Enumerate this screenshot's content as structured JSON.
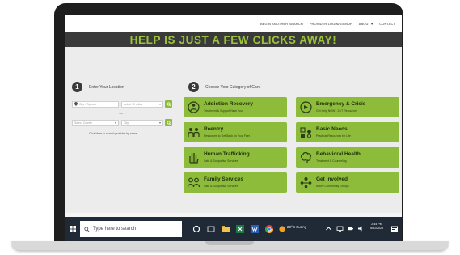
{
  "nav": {
    "items": [
      "BEGIN ANOTHER SEARCH",
      "PROVIDER LOGIN/SIGNUP",
      "ABOUT",
      "CONTACT"
    ],
    "about_chevron": "chevron-down-icon"
  },
  "banner": {
    "headline": "HELP IS JUST A FEW CLICKS AWAY!"
  },
  "step1": {
    "number": "1",
    "title": "Enter Your Location",
    "zip_placeholder": "City / Zipcode",
    "radius_value": "select 10 miles",
    "or_label": "- or -",
    "county_value": "Select County",
    "city_value": "City",
    "search_link_text": "Click Here to search provider by name"
  },
  "step2": {
    "number": "2",
    "title": "Choose Your Category of Care",
    "categories": [
      {
        "title": "Addiction Recovery",
        "subtitle": "Treatment & Support Near You",
        "icon": "recovery-icon"
      },
      {
        "title": "Emergency & Crisis",
        "subtitle": "Get Help NOW - 24/7 Resources",
        "icon": "emergency-icon"
      },
      {
        "title": "Reentry",
        "subtitle": "Resources to Get Back on Your Feet",
        "icon": "reentry-icon"
      },
      {
        "title": "Basic Needs",
        "subtitle": "Practical Resources for Life",
        "icon": "basic-needs-icon"
      },
      {
        "title": "Human Trafficking",
        "subtitle": "Safe & Supportive Services",
        "icon": "hand-icon"
      },
      {
        "title": "Behavioral Health",
        "subtitle": "Treatment & Counseling",
        "icon": "brain-icon"
      },
      {
        "title": "Family Services",
        "subtitle": "Safe & Supportive Services",
        "icon": "family-icon"
      },
      {
        "title": "Get Involved",
        "subtitle": "Active Community Groups",
        "icon": "community-icon"
      }
    ]
  },
  "taskbar": {
    "search_placeholder": "Type here to search",
    "weather": "29°C  Sunny",
    "time": "2:44 PM",
    "date": "5/31/2023"
  },
  "colors": {
    "accent_green": "#8dbb3a",
    "banner_bg": "#3a3a3a",
    "banner_text": "#9dc33b"
  }
}
